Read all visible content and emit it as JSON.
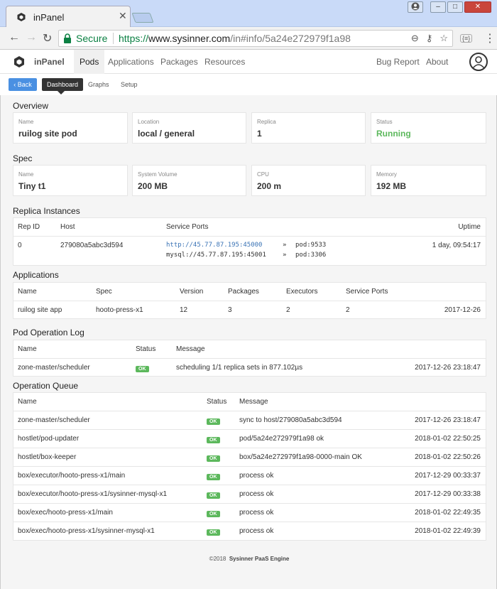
{
  "browser": {
    "tab_title": "inPanel",
    "secure_label": "Secure",
    "url_scheme": "https://",
    "url_host": "www.sysinner.com",
    "url_path": "/in#info/5a24e272979f1a98"
  },
  "appnav": {
    "app_name": "inPanel",
    "items": [
      "Pods",
      "Applications",
      "Packages",
      "Resources"
    ],
    "right_items": [
      "Bug Report",
      "About"
    ]
  },
  "subnav": {
    "back": "Back",
    "tabs": [
      "Dashboard",
      "Graphs",
      "Setup"
    ]
  },
  "overview": {
    "title": "Overview",
    "cards": [
      {
        "label": "Name",
        "value": "ruilog site pod"
      },
      {
        "label": "Location",
        "value": "local / general"
      },
      {
        "label": "Replica",
        "value": "1"
      },
      {
        "label": "Status",
        "value": "Running"
      }
    ]
  },
  "spec": {
    "title": "Spec",
    "cards": [
      {
        "label": "Name",
        "value": "Tiny t1"
      },
      {
        "label": "System Volume",
        "value": "200 MB"
      },
      {
        "label": "CPU",
        "value": "200 m"
      },
      {
        "label": "Memory",
        "value": "192 MB"
      }
    ]
  },
  "replicas": {
    "title": "Replica Instances",
    "headers": [
      "Rep ID",
      "Host",
      "Service Ports",
      "Uptime"
    ],
    "rows": [
      {
        "rep_id": "0",
        "host": "279080a5abc3d594",
        "port1_url": "http://45.77.87.195:45000",
        "port1_arrow": "»",
        "port1_target": "pod:9533",
        "port2_url": "mysql://45.77.87.195:45001",
        "port2_arrow": "»",
        "port2_target": "pod:3306",
        "uptime": "1 day, 09:54:17"
      }
    ]
  },
  "applications": {
    "title": "Applications",
    "headers": [
      "Name",
      "Spec",
      "Version",
      "Packages",
      "Executors",
      "Service Ports"
    ],
    "rows": [
      {
        "name": "ruilog site app",
        "spec": "hooto-press-x1",
        "version": "12",
        "packages": "3",
        "executors": "2",
        "ports": "2",
        "date": "2017-12-26"
      }
    ]
  },
  "oplog": {
    "title": "Pod Operation Log",
    "headers": [
      "Name",
      "Status",
      "Message"
    ],
    "rows": [
      {
        "name": "zone-master/scheduler",
        "status": "OK",
        "message": "scheduling 1/1 replica sets in 877.102µs",
        "time": "2017-12-26 23:18:47"
      }
    ]
  },
  "opqueue": {
    "title": "Operation Queue",
    "headers": [
      "Name",
      "Status",
      "Message"
    ],
    "rows": [
      {
        "name": "zone-master/scheduler",
        "status": "OK",
        "message": "sync to host/279080a5abc3d594",
        "time": "2017-12-26 23:18:47"
      },
      {
        "name": "hostlet/pod-updater",
        "status": "OK",
        "message": "pod/5a24e272979f1a98 ok",
        "time": "2018-01-02 22:50:25"
      },
      {
        "name": "hostlet/box-keeper",
        "status": "OK",
        "message": "box/5a24e272979f1a98-0000-main OK",
        "time": "2018-01-02 22:50:26"
      },
      {
        "name": "box/executor/hooto-press-x1/main",
        "status": "OK",
        "message": "process ok",
        "time": "2017-12-29 00:33:37"
      },
      {
        "name": "box/executor/hooto-press-x1/sysinner-mysql-x1",
        "status": "OK",
        "message": "process ok",
        "time": "2017-12-29 00:33:38"
      },
      {
        "name": "box/exec/hooto-press-x1/main",
        "status": "OK",
        "message": "process ok",
        "time": "2018-01-02 22:49:35"
      },
      {
        "name": "box/exec/hooto-press-x1/sysinner-mysql-x1",
        "status": "OK",
        "message": "process ok",
        "time": "2018-01-02 22:49:39"
      }
    ]
  },
  "footer": {
    "copyright": "©2018",
    "product": "Sysinner PaaS Engine"
  },
  "colors": {
    "accent": "#4a90e2",
    "ok": "#5cb85c",
    "secure": "#0b8043"
  }
}
